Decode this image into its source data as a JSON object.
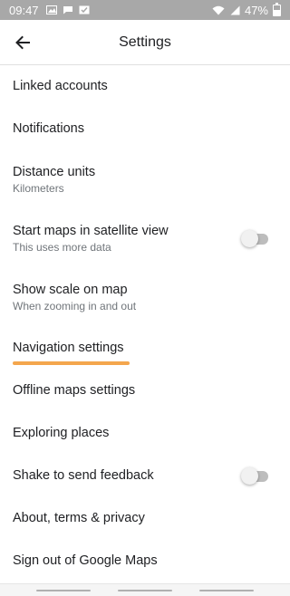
{
  "status_bar": {
    "time": "09:47",
    "battery": "47%"
  },
  "app_bar": {
    "title": "Settings",
    "back_icon": "arrow-back-icon"
  },
  "settings": {
    "items": [
      {
        "title": "Linked accounts"
      },
      {
        "title": "Notifications"
      },
      {
        "title": "Distance units",
        "subtitle": "Kilometers"
      },
      {
        "title": "Start maps in satellite view",
        "subtitle": "This uses more data",
        "toggle": false
      },
      {
        "title": "Show scale on map",
        "subtitle": "When zooming in and out"
      },
      {
        "title": "Navigation settings",
        "highlighted": true
      },
      {
        "title": "Offline maps settings"
      },
      {
        "title": "Exploring places"
      },
      {
        "title": "Shake to send feedback",
        "toggle": false
      },
      {
        "title": "About, terms & privacy"
      },
      {
        "title": "Sign out of Google Maps"
      }
    ]
  },
  "colors": {
    "highlight": "#f4a64d",
    "status_bar": "#a8a8a8",
    "toggle_track": "#bdbdbd"
  }
}
